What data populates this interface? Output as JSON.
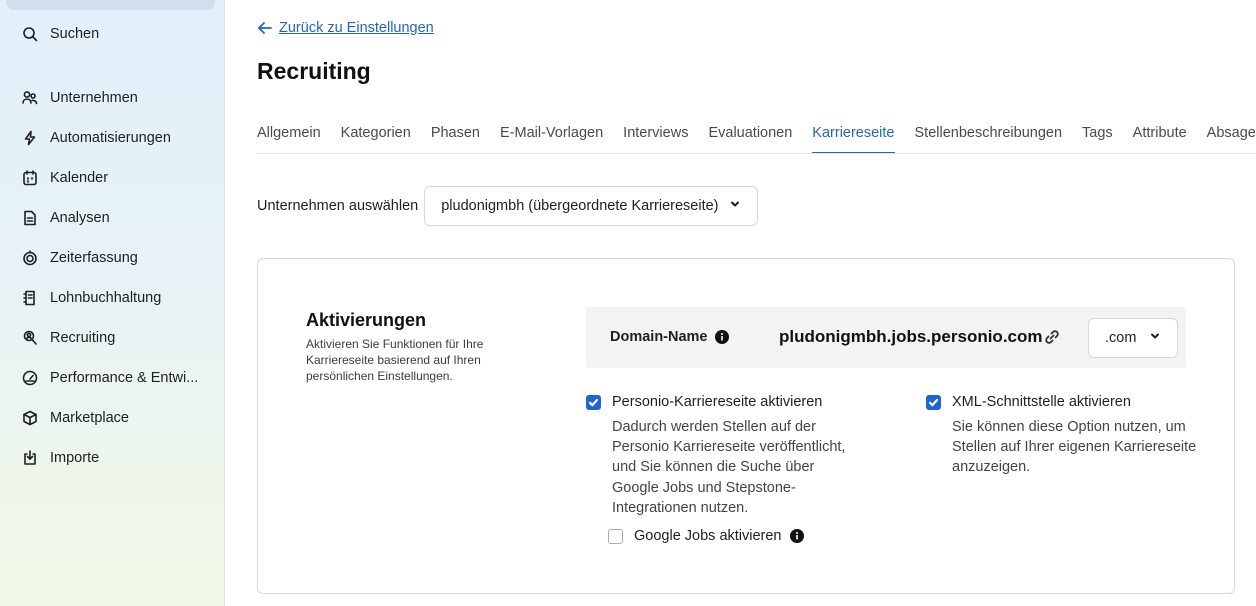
{
  "sidebar": {
    "items": [
      {
        "label": "Suchen",
        "icon": "search-icon"
      },
      {
        "label": "Unternehmen",
        "icon": "people-icon"
      },
      {
        "label": "Automatisierungen",
        "icon": "bolt-icon"
      },
      {
        "label": "Kalender",
        "icon": "calendar-icon"
      },
      {
        "label": "Analysen",
        "icon": "document-icon"
      },
      {
        "label": "Zeiterfassung",
        "icon": "timer-icon"
      },
      {
        "label": "Lohnbuchhaltung",
        "icon": "payroll-icon"
      },
      {
        "label": "Recruiting",
        "icon": "recruiting-icon"
      },
      {
        "label": "Performance & Entwi...",
        "icon": "gauge-icon"
      },
      {
        "label": "Marketplace",
        "icon": "box-icon"
      },
      {
        "label": "Importe",
        "icon": "import-icon"
      }
    ]
  },
  "header": {
    "back_label": "Zurück zu Einstellungen",
    "title": "Recruiting"
  },
  "tabs": [
    {
      "label": "Allgemein",
      "active": false
    },
    {
      "label": "Kategorien",
      "active": false
    },
    {
      "label": "Phasen",
      "active": false
    },
    {
      "label": "E-Mail-Vorlagen",
      "active": false
    },
    {
      "label": "Interviews",
      "active": false
    },
    {
      "label": "Evaluationen",
      "active": false
    },
    {
      "label": "Karriereseite",
      "active": true
    },
    {
      "label": "Stellenbeschreibungen",
      "active": false
    },
    {
      "label": "Tags",
      "active": false
    },
    {
      "label": "Attribute",
      "active": false
    },
    {
      "label": "Absage",
      "active": false
    }
  ],
  "company": {
    "label": "Unternehmen auswählen",
    "selected": "pludonigmbh (übergeordnete Karriereseite)"
  },
  "activations": {
    "title": "Aktivierungen",
    "description": "Aktivieren Sie Funktionen für Ihre Karriereseite basierend auf Ihren persönlichen Einstellungen.",
    "domain_label": "Domain-Name",
    "domain_value": "pludonigmbh.jobs.personio.com",
    "tld_selected": ".com",
    "options": {
      "career_page": {
        "label": "Personio-Karriereseite aktivieren",
        "checked": true,
        "description": "Dadurch werden Stellen auf der Personio Karriereseite veröffentlicht, und Sie können die Suche über Google Jobs und Stepstone-Integrationen nutzen."
      },
      "google_jobs": {
        "label": "Google Jobs aktivieren",
        "checked": false
      },
      "xml": {
        "label": "XML-Schnittstelle aktivieren",
        "checked": true,
        "description": "Sie können diese Option nutzen, um Stellen auf Ihrer eigenen Karriereseite anzuzeigen."
      }
    }
  },
  "colors": {
    "accent": "#2364c8",
    "checkbox": "#1d66d1"
  }
}
